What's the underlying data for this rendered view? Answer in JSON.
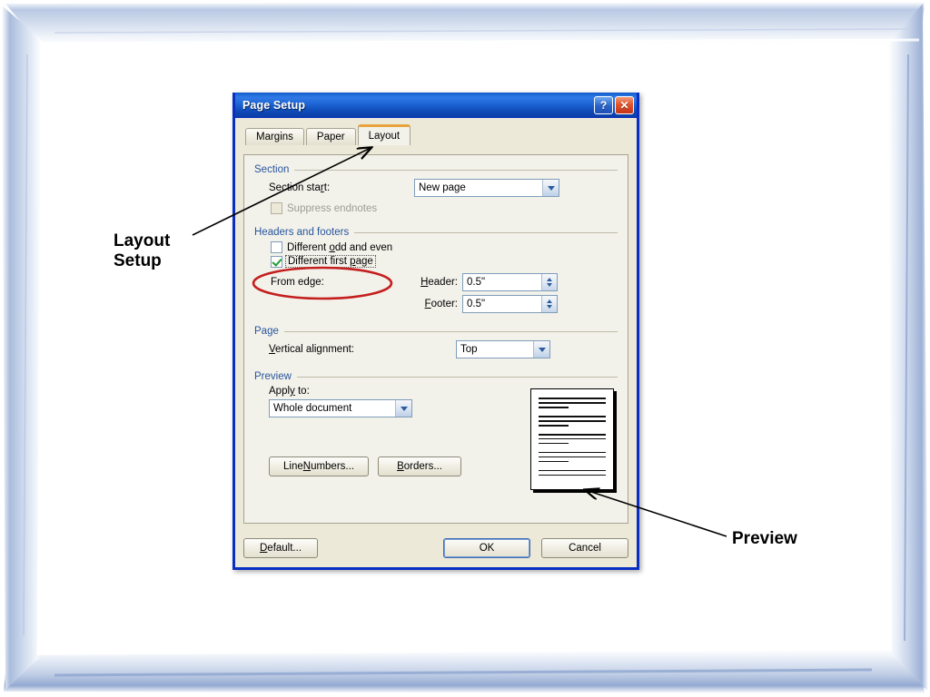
{
  "frame": {
    "accent_color": "#7d99c9",
    "background": "#ffffff"
  },
  "dialog": {
    "title": "Page Setup",
    "titlebar_color": "#1f69d8",
    "border_color": "#0a2ec1",
    "face_color": "#ece9d8",
    "help_button": "?",
    "close_button": "✕",
    "tabs": [
      {
        "label": "Margins",
        "active": false
      },
      {
        "label": "Paper",
        "active": false
      },
      {
        "label": "Layout",
        "active": true
      }
    ],
    "section_group": {
      "title": "Section",
      "section_start_label": "Section start:",
      "section_start_value": "New page",
      "suppress_endnotes_label": "Suppress endnotes",
      "suppress_endnotes_checked": false,
      "suppress_endnotes_disabled": true
    },
    "headers_footers_group": {
      "title": "Headers and footers",
      "different_odd_even_label": "Different odd and even",
      "different_odd_even_checked": false,
      "different_first_page_label": "Different first page",
      "different_first_page_checked": true,
      "from_edge_label": "From edge:",
      "header_label": "Header:",
      "header_value": "0.5\"",
      "footer_label": "Footer:",
      "footer_value": "0.5\""
    },
    "page_group": {
      "title": "Page",
      "vertical_alignment_label": "Vertical alignment:",
      "vertical_alignment_value": "Top"
    },
    "preview_group": {
      "title": "Preview",
      "apply_to_label": "Apply to:",
      "apply_to_value": "Whole document",
      "line_numbers_button": "Line Numbers...",
      "borders_button": "Borders..."
    },
    "footer_buttons": {
      "default_button": "Default...",
      "ok_button": "OK",
      "cancel_button": "Cancel"
    }
  },
  "annotations": {
    "layout_setup": "Layout\nSetup",
    "preview": "Preview",
    "color": "#000000"
  }
}
